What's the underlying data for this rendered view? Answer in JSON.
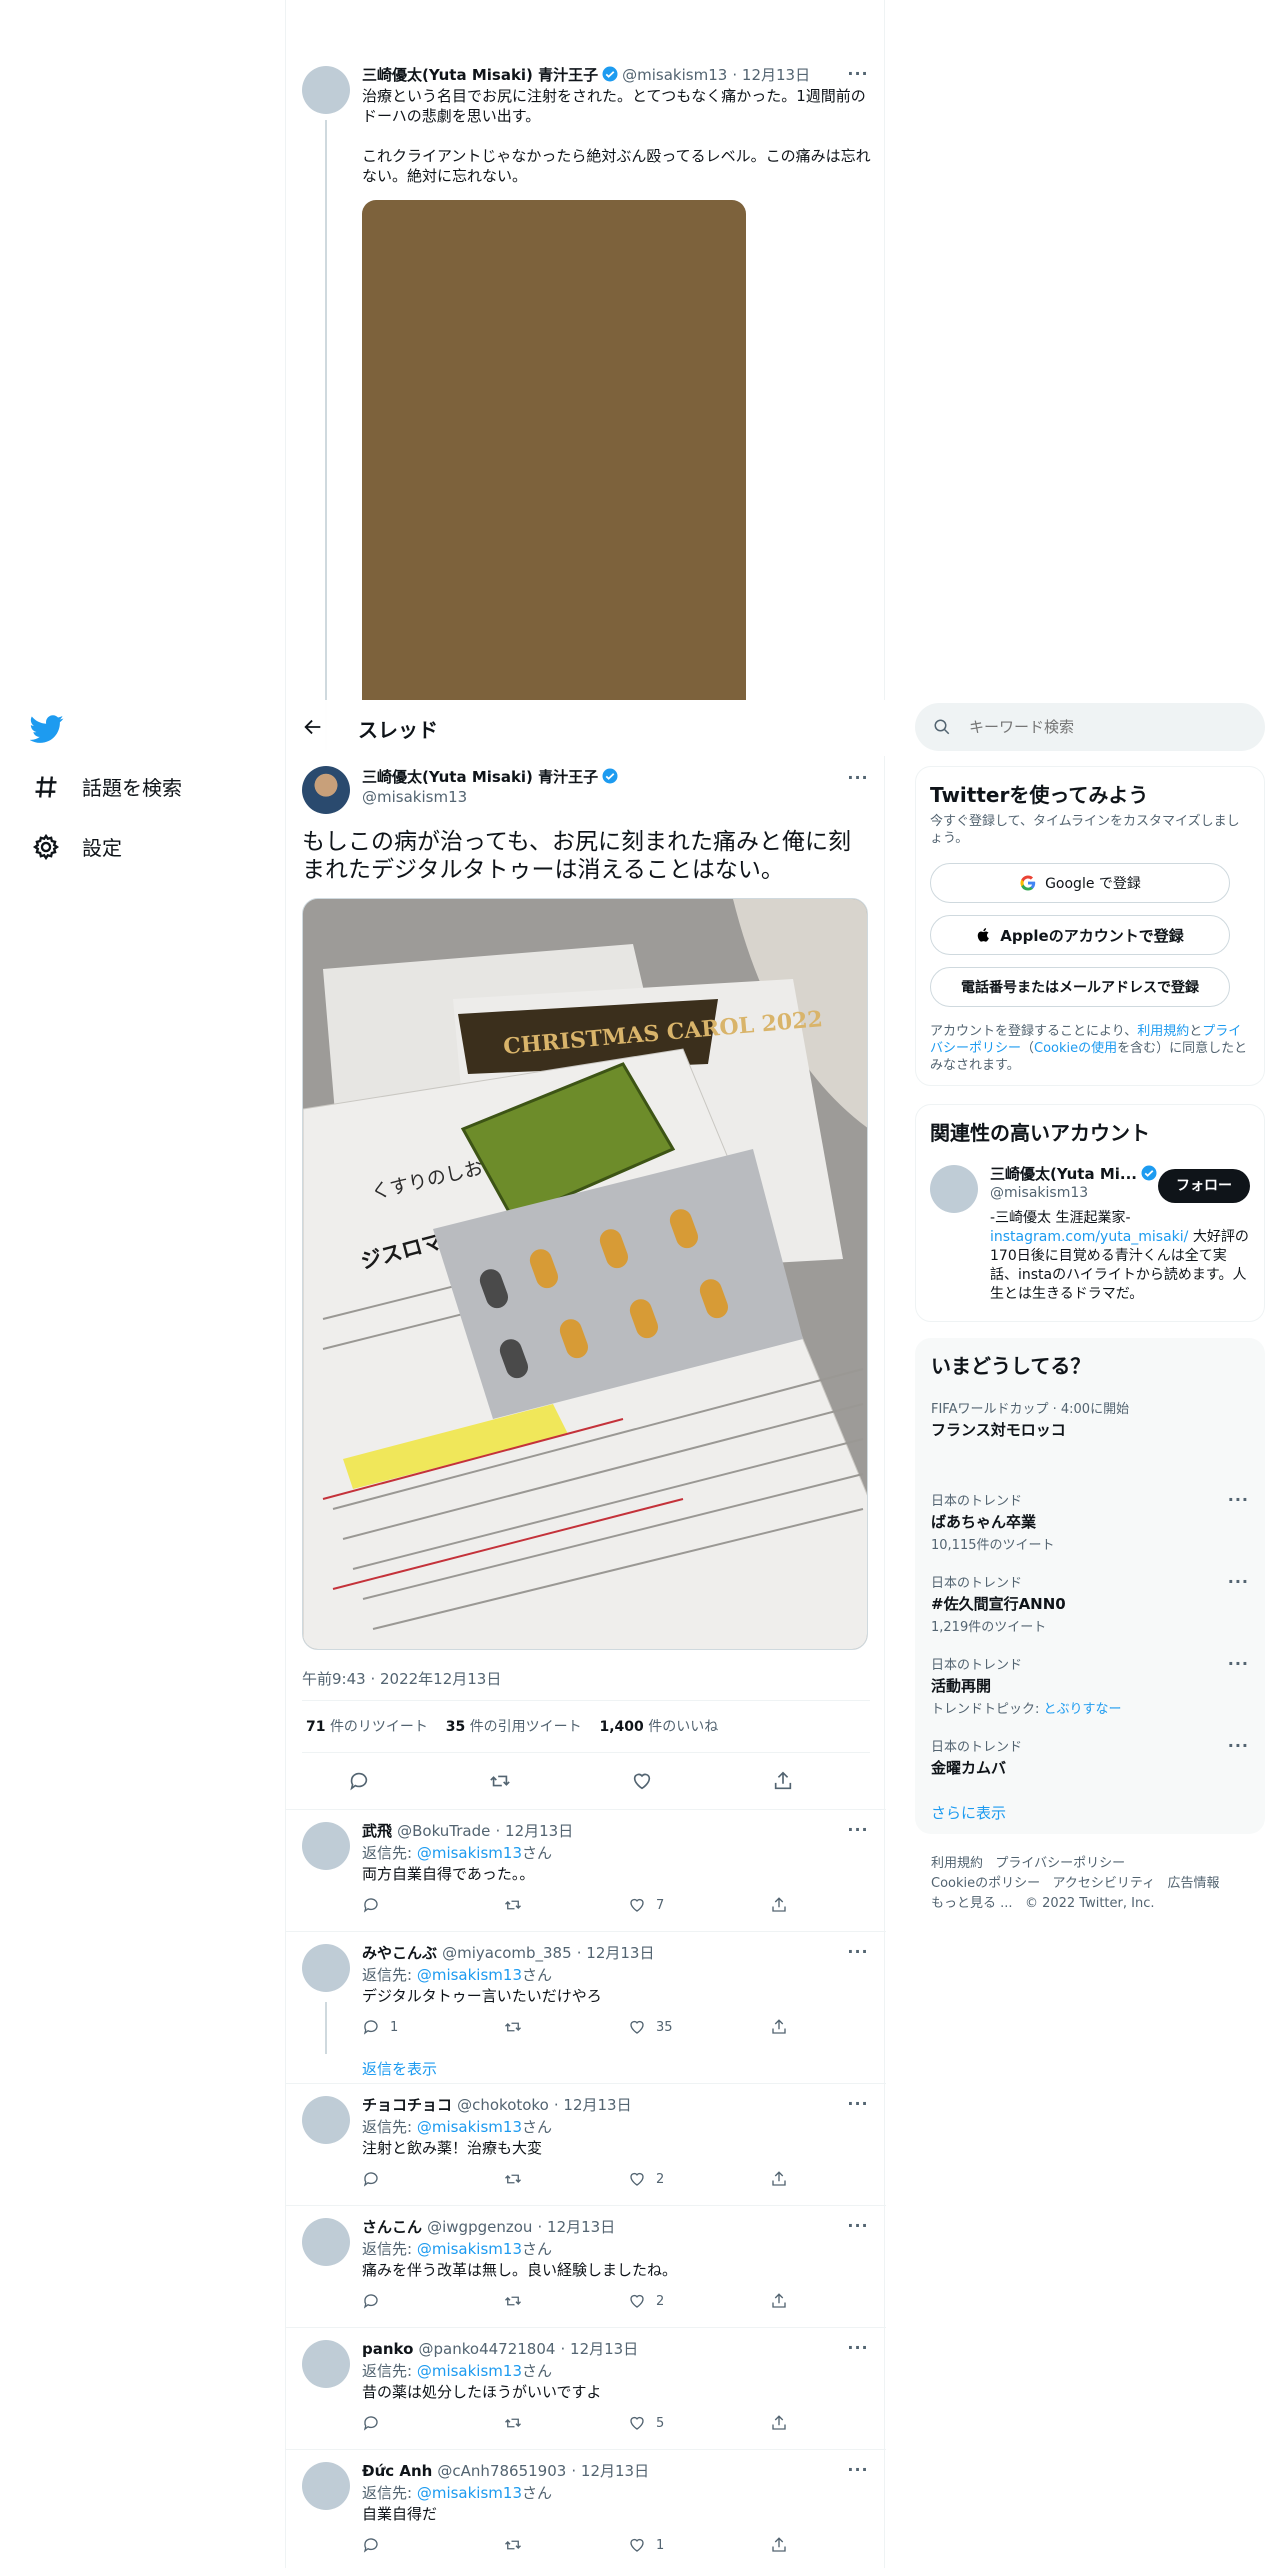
{
  "nav": {
    "explore_label": "話題を検索",
    "settings_label": "設定"
  },
  "quoted_tweet": {
    "name": "三崎優太(Yuta Misaki) 青汁王子",
    "handle": "@misakism13",
    "date": "· 12月13日",
    "text": "治療という名目でお尻に注射をされた。とてつもなく痛かった。1週間前のドーハの悲劇を思い出す。\n\nこれクライアントじゃなかったら絶対ぶん殴ってるレベル。この痛みは忘れない。絶対に忘れない。",
    "image_color": "#7d623c"
  },
  "thread_header": {
    "title": "スレッド"
  },
  "main_tweet": {
    "name": "三崎優太(Yuta Misaki) 青汁王子",
    "handle": "@misakism13",
    "text": "もしこの病が治っても、お尻に刻まれた痛みと俺に刻まれたデジタルタトゥーは消えることはない。",
    "timestamp": "午前9:43 · 2022年12月13日",
    "retweets_count": "71",
    "retweets_label": "件のリツイート",
    "quotes_count": "35",
    "quotes_label": "件の引用ツイート",
    "likes_count": "1,400",
    "likes_label": "件のいいね",
    "photo_labels": {
      "leaflet": "くすりのしおり",
      "drug": "ジスロマイシン錠 250mg",
      "card": "CHRISTMAS CAROL 2022"
    }
  },
  "replies": [
    {
      "name": "武飛",
      "handle": "@BokuTrade",
      "date": "· 12月13日",
      "reply_to_prefix": "返信先: ",
      "reply_to": "@misakism13",
      "reply_to_suffix": "さん",
      "text": "両方自業自得であった。。",
      "reply_count": "",
      "retweet_count": "",
      "like_count": "7"
    },
    {
      "name": "みやこんぶ",
      "handle": "@miyacomb_385",
      "date": "· 12月13日",
      "reply_to_prefix": "返信先: ",
      "reply_to": "@misakism13",
      "reply_to_suffix": "さん",
      "text": "デジタルタトゥー言いたいだけやろ",
      "reply_count": "1",
      "retweet_count": "",
      "like_count": "35",
      "show_replies": "返信を表示"
    },
    {
      "name": "チョコチョコ",
      "handle": "@chokotoko",
      "date": "· 12月13日",
      "reply_to_prefix": "返信先: ",
      "reply_to": "@misakism13",
      "reply_to_suffix": "さん",
      "text": "注射と飲み薬！治療も大変",
      "reply_count": "",
      "retweet_count": "",
      "like_count": "2"
    },
    {
      "name": "さんこん",
      "handle": "@iwgpgenzou",
      "date": "· 12月13日",
      "reply_to_prefix": "返信先: ",
      "reply_to": "@misakism13",
      "reply_to_suffix": "さん",
      "text": "痛みを伴う改革は無し。良い経験しましたね。",
      "reply_count": "",
      "retweet_count": "",
      "like_count": "2"
    },
    {
      "name": "panko",
      "handle": "@panko44721804",
      "date": "· 12月13日",
      "reply_to_prefix": "返信先: ",
      "reply_to": "@misakism13",
      "reply_to_suffix": "さん",
      "text": "昔の薬は処分したほうがいいですよ",
      "reply_count": "",
      "retweet_count": "",
      "like_count": "5"
    },
    {
      "name": "Đức Anh",
      "handle": "@cAnh78651903",
      "date": "· 12月13日",
      "reply_to_prefix": "返信先: ",
      "reply_to": "@misakism13",
      "reply_to_suffix": "さん",
      "text": "自業自得だ",
      "reply_count": "",
      "retweet_count": "",
      "like_count": "1"
    }
  ],
  "search": {
    "placeholder": "キーワード検索"
  },
  "signup": {
    "title": "Twitterを使ってみよう",
    "subtitle": "今すぐ登録して、タイムラインをカスタマイズしましょう。",
    "google_label": "Google で登録",
    "apple_label": "Appleのアカウントで登録",
    "phone_label": "電話番号またはメールアドレスで登録",
    "terms_prefix": "アカウントを登録することにより、",
    "terms_link": "利用規約",
    "terms_and": "と",
    "privacy_link": "プライバシーポリシー",
    "cookie_open": "（",
    "cookie_link": "Cookieの使用",
    "terms_suffix": "を含む）に同意したとみなされます。"
  },
  "relevant": {
    "title": "関連性の高いアカウント",
    "name": "三崎優太(Yuta Mi...",
    "handle": "@misakism13",
    "follow_label": "フォロー",
    "bio_prefix": "-三崎優太 生涯起業家-",
    "bio_link": "instagram.com/yuta_misaki/",
    "bio_suffix": " 大好評の170日後に目覚める青汁くんは全て実話、instaのハイライトから読めます。人生とは生きるドラマだ。"
  },
  "trends": {
    "title": "いまどうしてる？",
    "items": [
      {
        "meta": "FIFAワールドカップ · 4:00に開始",
        "name": "フランス対モロッコ",
        "sub": ""
      },
      {
        "meta": "日本のトレンド",
        "name": "ばあちゃん卒業",
        "sub": "10,115件のツイート"
      },
      {
        "meta": "日本のトレンド",
        "name": "#佐久間宣行ANN0",
        "sub": "1,219件のツイート"
      },
      {
        "meta": "日本のトレンド",
        "name": "活動再開",
        "sub_prefix": "トレンドトピック: ",
        "sub_link": "とぶりすなー"
      },
      {
        "meta": "日本のトレンド",
        "name": "金曜カムバ",
        "sub": ""
      }
    ],
    "show_more": "さらに表示"
  },
  "footer": {
    "terms": "利用規約",
    "privacy": "プライバシーポリシー",
    "cookie": "Cookieのポリシー",
    "accessibility": "アクセシビリティ",
    "ads": "広告情報",
    "more": "もっと見る ...",
    "copyright": "© 2022 Twitter, Inc."
  },
  "colors": {
    "accent": "#1d9bf0",
    "text": "#0f1419",
    "secondary": "#536471"
  }
}
